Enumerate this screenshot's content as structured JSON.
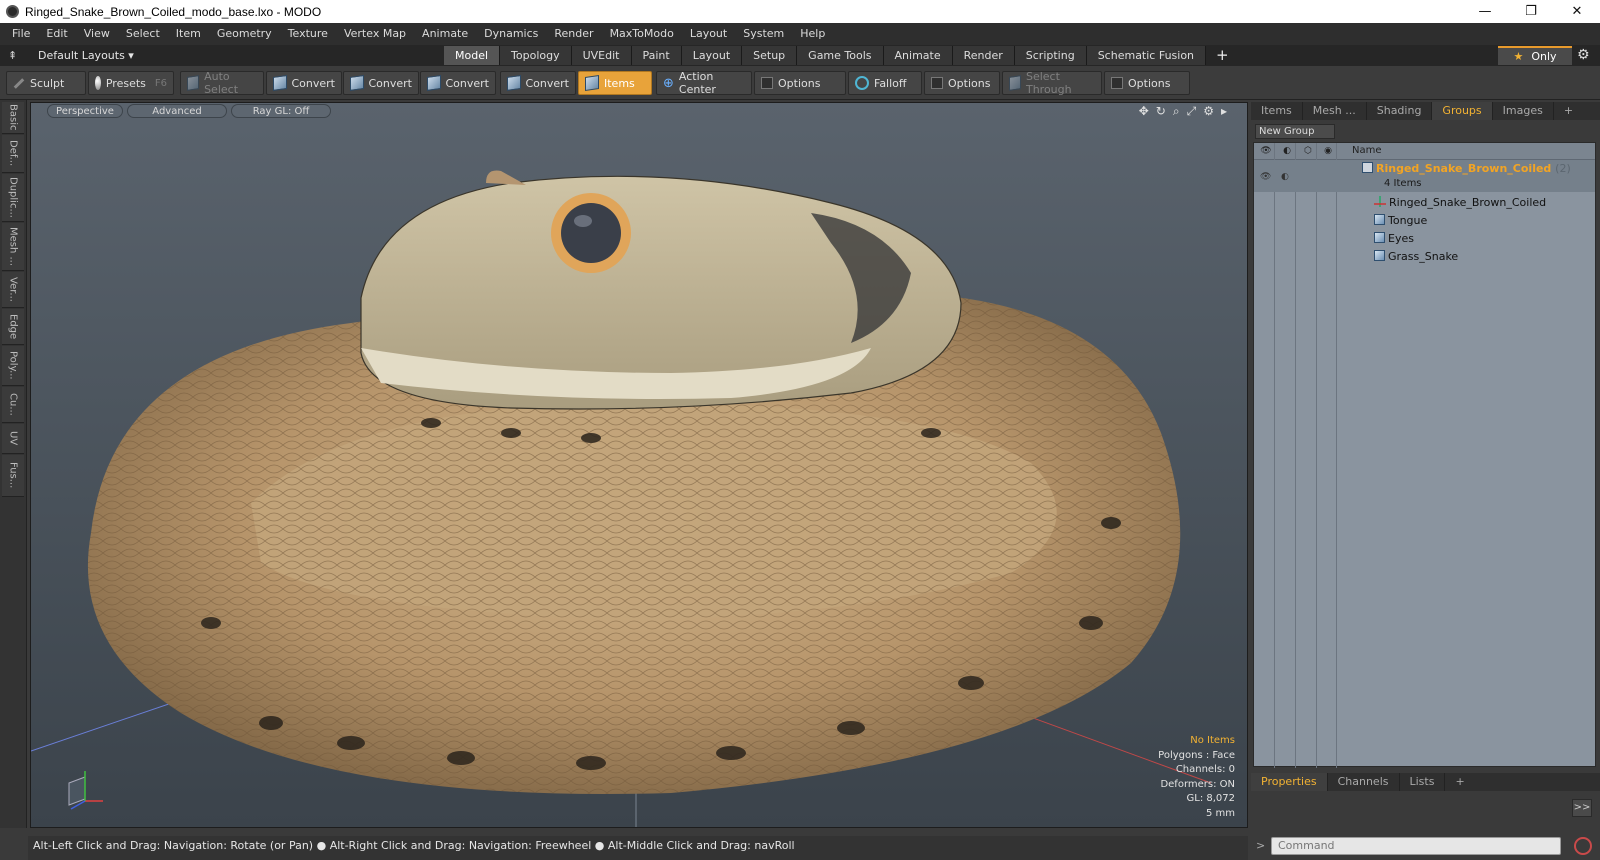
{
  "window": {
    "title": "Ringed_Snake_Brown_Coiled_modo_base.lxo - MODO",
    "minimize": "—",
    "restore": "❐",
    "close": "✕"
  },
  "menu": [
    "File",
    "Edit",
    "View",
    "Select",
    "Item",
    "Geometry",
    "Texture",
    "Vertex Map",
    "Animate",
    "Dynamics",
    "Render",
    "MaxToModo",
    "Layout",
    "System",
    "Help"
  ],
  "layoutbar": {
    "layout_select": "Default Layouts ▾",
    "tabs": [
      "Model",
      "Topology",
      "UVEdit",
      "Paint",
      "Layout",
      "Setup",
      "Game Tools",
      "Animate",
      "Render",
      "Scripting",
      "Schematic Fusion"
    ],
    "active_tab": "Model",
    "add_tab": "+",
    "only_label": "Only"
  },
  "toolbar": {
    "sculpt": "Sculpt",
    "presets": "Presets",
    "presets_key": "F6",
    "auto_select": "Auto Select",
    "convert1": "Convert",
    "convert2": "Convert",
    "convert3": "Convert",
    "convert4": "Convert",
    "items": "Items",
    "action_center": "Action Center",
    "options1": "Options",
    "falloff": "Falloff",
    "options2": "Options",
    "select_through": "Select Through",
    "options3": "Options"
  },
  "left_tabs": [
    "Basic",
    "Def...",
    "Duplic...",
    "Mesh ...",
    "Ver...",
    "Edge",
    "Poly...",
    "Cu...",
    "UV",
    "Fus..."
  ],
  "viewport": {
    "view_mode": "Perspective",
    "shading": "Advanced",
    "raygl": "Ray GL: Off",
    "info": {
      "selection": "No Items",
      "polygons": "Polygons : Face",
      "channels": "Channels: 0",
      "deformers": "Deformers: ON",
      "gl": "GL: 8,072",
      "scale": "5 mm"
    }
  },
  "statusbar": {
    "text": "Alt-Left Click and Drag: Navigation: Rotate (or Pan) ● Alt-Right Click and Drag: Navigation: Freewheel ● Alt-Middle Click and Drag: navRoll"
  },
  "right_panel": {
    "tabs": [
      "Items",
      "Mesh ...",
      "Shading",
      "Groups",
      "Images"
    ],
    "active_tab": "Groups",
    "add": "+",
    "new_group": "New Group",
    "name_header": "Name",
    "group": {
      "name": "Ringed_Snake_Brown_Coiled",
      "count": "(2)",
      "items_label": "4 Items"
    },
    "children": [
      {
        "name": "Ringed_Snake_Brown_Coiled",
        "icon": "locator-icon"
      },
      {
        "name": "Tongue",
        "icon": "mesh-icon"
      },
      {
        "name": "Eyes",
        "icon": "mesh-icon"
      },
      {
        "name": "Grass_Snake",
        "icon": "mesh-icon"
      }
    ]
  },
  "bottom_panel": {
    "tabs": [
      "Properties",
      "Channels",
      "Lists"
    ],
    "active_tab": "Properties",
    "add": "+",
    "expand": ">>",
    "command_placeholder": "Command"
  }
}
